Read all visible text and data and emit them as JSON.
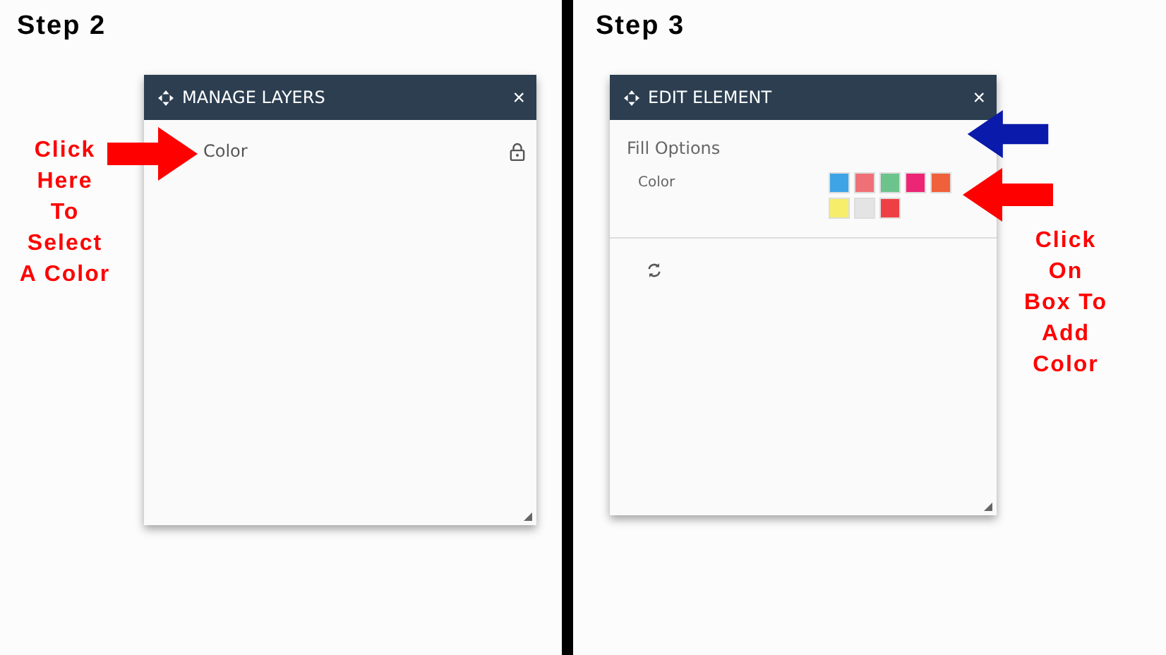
{
  "steps": [
    {
      "label": "Step 2",
      "panel": {
        "kind": "layers",
        "title": "MANAGE LAYERS",
        "close": "×",
        "layers": [
          {
            "name": "Color",
            "locked": true
          }
        ]
      },
      "annotations": [
        {
          "text": "Click\nHere\nTo\nSelect\nA Color"
        }
      ],
      "arrows": [
        {
          "color": "#ff0000"
        }
      ]
    },
    {
      "label": "Step 3",
      "panel": {
        "kind": "edit",
        "title": "EDIT ELEMENT",
        "close": "×",
        "section": "Fill Options",
        "field": "Color",
        "swatches": [
          {
            "color": "#3ea4e6"
          },
          {
            "color": "#f07078"
          },
          {
            "color": "#6cc38c"
          },
          {
            "color": "#ec2574"
          },
          {
            "color": "#f0603a"
          },
          {
            "color": "#f6ee6a"
          },
          {
            "color": "#e4e4e4"
          },
          {
            "color": "#ee4044"
          }
        ]
      },
      "annotations": [
        {
          "text": "Click\nOn\nBox To\nAdd\nColor"
        }
      ],
      "arrows": [
        {
          "color": "#0a1aaa"
        },
        {
          "color": "#ff0000"
        }
      ]
    }
  ]
}
